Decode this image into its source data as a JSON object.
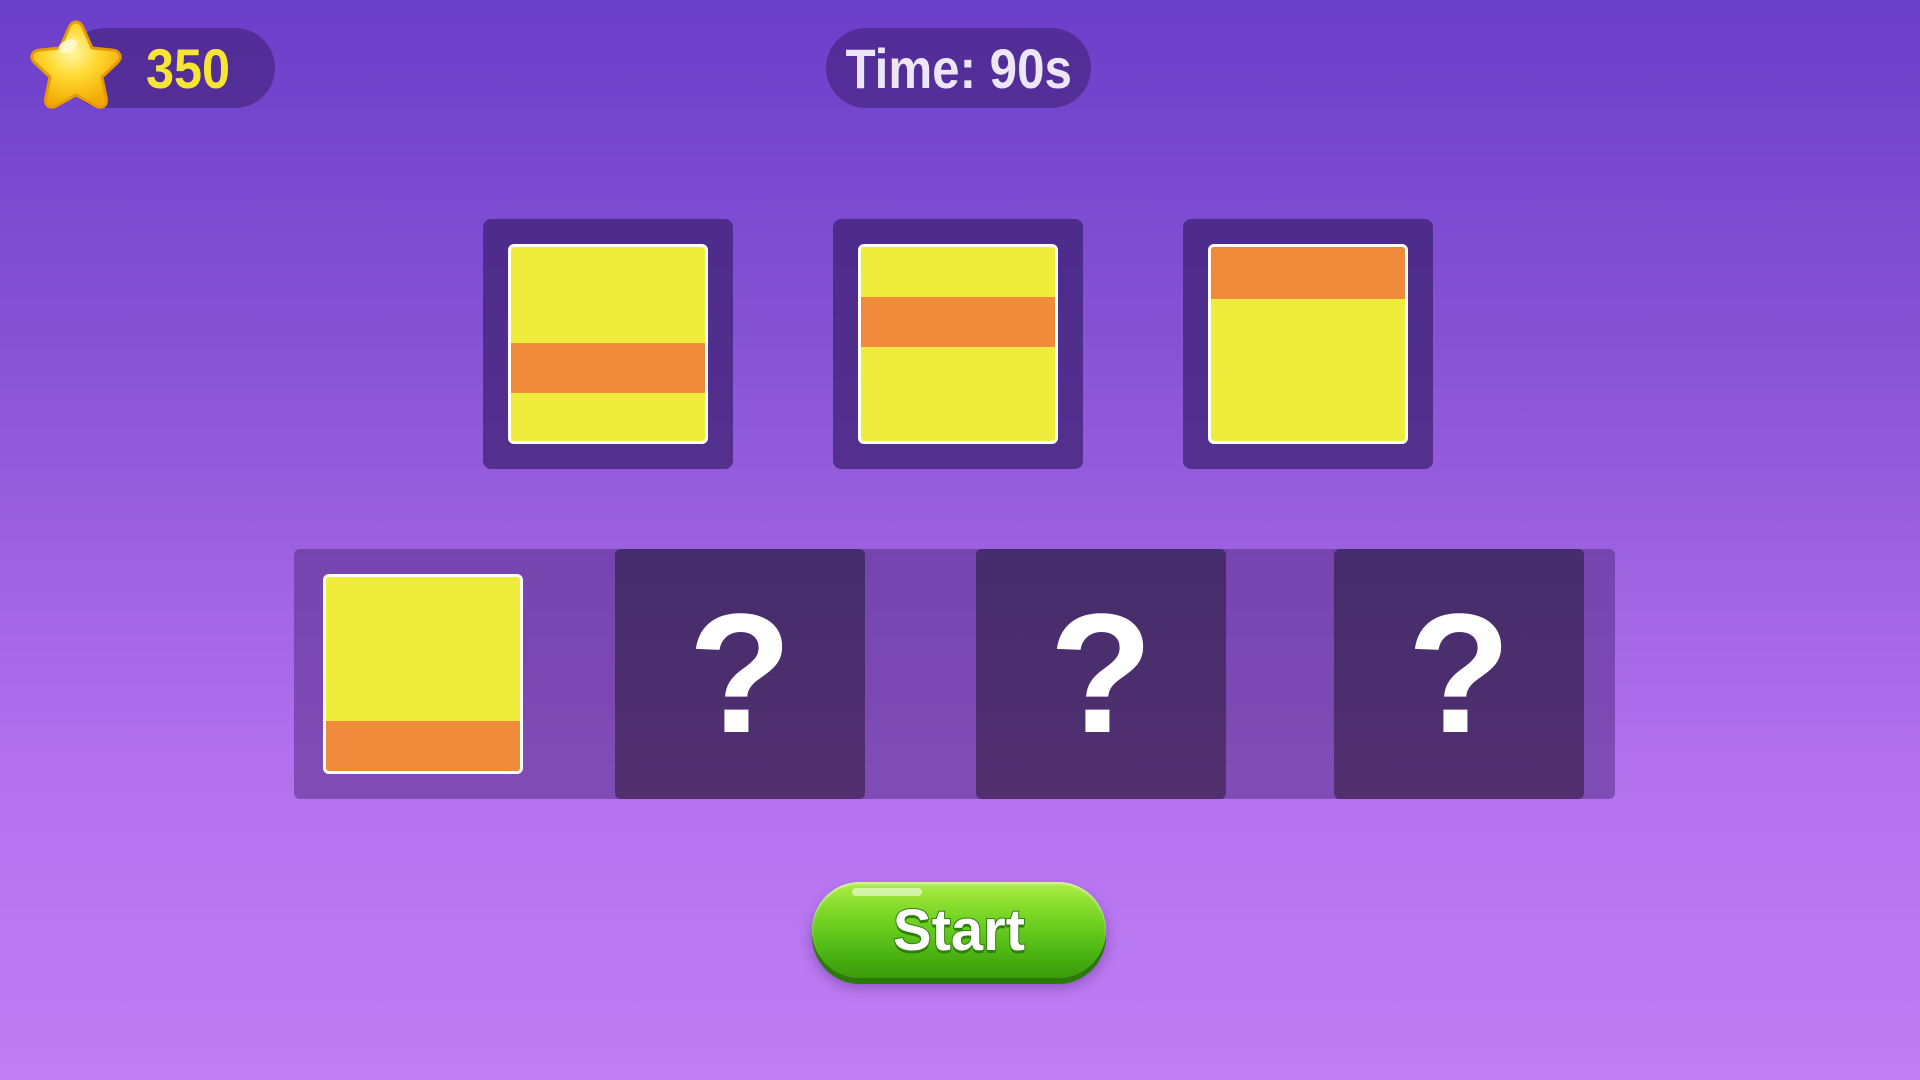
{
  "hud": {
    "score": "350",
    "timer": "Time: 90s"
  },
  "pattern_cards": [
    {
      "stripe_position": "lower-middle"
    },
    {
      "stripe_position": "upper-middle"
    },
    {
      "stripe_position": "top"
    }
  ],
  "answer_slots": [
    {
      "state": "filled",
      "stripe_position": "bottom"
    },
    {
      "state": "hidden",
      "label": "?"
    },
    {
      "state": "hidden",
      "label": "?"
    },
    {
      "state": "hidden",
      "label": "?"
    }
  ],
  "buttons": {
    "start_label": "Start"
  },
  "colors": {
    "tile_yellow": "#efec3b",
    "stripe_orange": "#f08b3b",
    "score_text": "#f6e533",
    "button_green": "#5cc41a"
  },
  "icons": {
    "score": "star-icon"
  }
}
